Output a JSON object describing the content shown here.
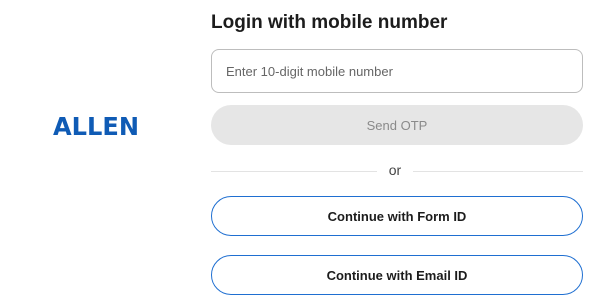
{
  "brand": {
    "logo_text": "ALLEN",
    "color": "#0f5bb5"
  },
  "login": {
    "title": "Login with mobile number",
    "mobile_placeholder": "Enter 10-digit mobile number",
    "send_otp_label": "Send OTP",
    "divider_text": "or",
    "form_id_label": "Continue with Form ID",
    "email_id_label": "Continue with Email ID"
  },
  "colors": {
    "accent": "#1f6fd1",
    "disabled_bg": "#e6e6e6",
    "disabled_text": "#8a8a8a"
  }
}
